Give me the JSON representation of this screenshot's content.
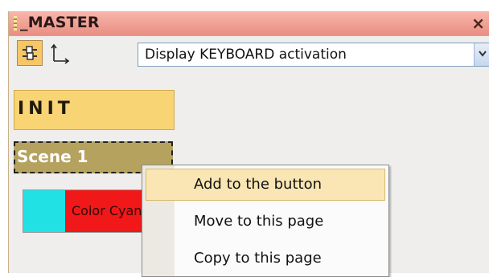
{
  "window": {
    "title": "_MASTER",
    "close_symbol": "×"
  },
  "toolbar": {
    "layout_tool_icon": "sliders-icon",
    "axes_tool_icon": "axes-icon",
    "display_select": {
      "value": "Display KEYBOARD activation"
    }
  },
  "buttons": {
    "init_label": "INIT",
    "scene_label": "Scene 1",
    "color_label": "Color Cyan",
    "colors": {
      "init": "#f8d474",
      "scene": "#b5a25f",
      "swatch": "#21e1e4",
      "color_fill": "#f01818"
    }
  },
  "context_menu": {
    "items": [
      {
        "label": "Add to the button",
        "highlighted": true
      },
      {
        "label": "Move to this page",
        "highlighted": false
      },
      {
        "label": "Copy to this page",
        "highlighted": false
      }
    ]
  }
}
